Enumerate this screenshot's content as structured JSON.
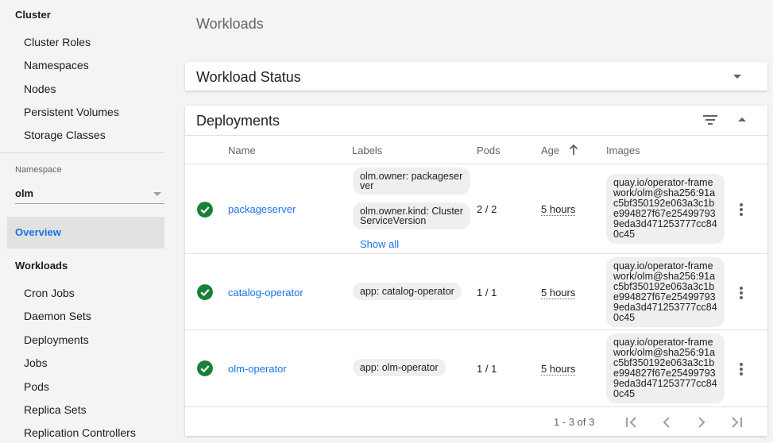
{
  "sidebar": {
    "cluster_heading": "Cluster",
    "cluster_items": [
      "Cluster Roles",
      "Namespaces",
      "Nodes",
      "Persistent Volumes",
      "Storage Classes"
    ],
    "namespace_label": "Namespace",
    "namespace_value": "olm",
    "overview": "Overview",
    "workloads_heading": "Workloads",
    "workload_items": [
      "Cron Jobs",
      "Daemon Sets",
      "Deployments",
      "Jobs",
      "Pods",
      "Replica Sets",
      "Replication Controllers"
    ]
  },
  "page_title": "Workloads",
  "workload_status": {
    "title": "Workload Status"
  },
  "deployments": {
    "title": "Deployments",
    "columns": {
      "name": "Name",
      "labels": "Labels",
      "pods": "Pods",
      "age": "Age",
      "images": "Images"
    },
    "rows": [
      {
        "name": "packageserver",
        "labels": [
          "olm.owner: packageserver",
          "olm.owner.kind: ClusterServiceVersion"
        ],
        "show_all": "Show all",
        "pods": "2 / 2",
        "age": "5 hours",
        "image": "quay.io/operator-framework/olm@sha256:91ac5bf350192e063a3c1be994827f67e254997939eda3d471253777cc840c45"
      },
      {
        "name": "catalog-operator",
        "labels": [
          "app: catalog-operator"
        ],
        "pods": "1 / 1",
        "age": "5 hours",
        "image": "quay.io/operator-framework/olm@sha256:91ac5bf350192e063a3c1be994827f67e254997939eda3d471253777cc840c45"
      },
      {
        "name": "olm-operator",
        "labels": [
          "app: olm-operator"
        ],
        "pods": "1 / 1",
        "age": "5 hours",
        "image": "quay.io/operator-framework/olm@sha256:91ac5bf350192e063a3c1be994827f67e254997939eda3d471253777cc840c45"
      }
    ],
    "pagination": "1 - 3 of 3"
  },
  "icons": {
    "status": "check-circle-icon",
    "filter": "filter-icon",
    "more": "more-vert-icon",
    "first_page": "first-page-icon",
    "prev_page": "chevron-left-icon",
    "next_page": "chevron-right-icon",
    "last_page": "last-page-icon"
  },
  "colors": {
    "accent": "#1a73e8",
    "success": "#188038",
    "active_bg": "#e1e1e1"
  }
}
